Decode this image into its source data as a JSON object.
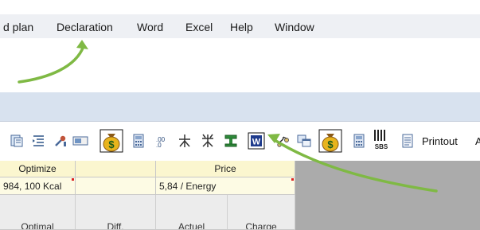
{
  "menu": [
    "d plan",
    "Declaration",
    "Word",
    "Excel",
    "Help",
    "Window"
  ],
  "toolbar": {
    "icons": [
      "document-icon",
      "indent-icon",
      "tools-icon",
      "bar-icon",
      "money-bag-icon",
      "calculator-icon",
      "decimal-icon",
      "tree-icon",
      "flower-icon",
      "green-table-icon",
      "word-icon",
      "scales-icon",
      "windows-icon",
      "money-bag-icon",
      "calculator-icon",
      "sbs-icon",
      "note-icon"
    ],
    "word_glyph": "W",
    "sbs_glyph": "SBS",
    "printout_label": "Printout",
    "cut_label": "A"
  },
  "grid": {
    "optimize_header": "Optimize",
    "optimize_value": "984, 100 Kcal",
    "price_header": "Price",
    "price_value": "5,84 / Energy",
    "buttons": [
      "Optimal",
      "Diff.",
      "Actuel",
      "Charge"
    ]
  },
  "colors": {
    "menubar": "#eef0f4",
    "panel_band": "#d8e2ef",
    "header_cell": "#fbf6cf",
    "value_cell": "#fdfbe4",
    "grid_background": "#ababab",
    "arrow": "#7fb944",
    "marker": "#dd2222"
  }
}
